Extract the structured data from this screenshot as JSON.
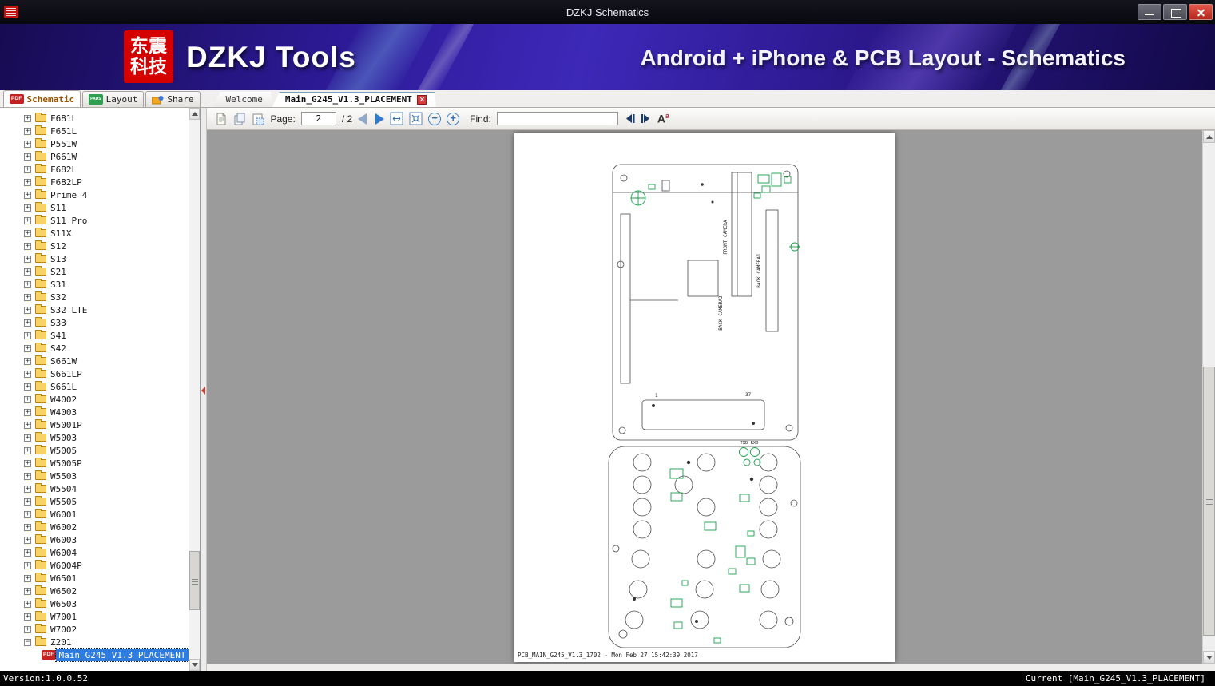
{
  "window": {
    "title": "DZKJ Schematics"
  },
  "banner": {
    "logo_line1": "东震",
    "logo_line2": "科技",
    "app_name": "DZKJ Tools",
    "tagline": "Android + iPhone & PCB Layout - Schematics"
  },
  "mode_tabs": [
    {
      "label": "Schematic",
      "active": true
    },
    {
      "label": "Layout",
      "active": false
    },
    {
      "label": "Share",
      "active": false
    }
  ],
  "doc_tabs": [
    {
      "label": "Welcome",
      "active": false,
      "closable": false
    },
    {
      "label": "Main_G245_V1.3_PLACEMENT",
      "active": true,
      "closable": true
    }
  ],
  "sidebar": {
    "items": [
      {
        "label": "F681L"
      },
      {
        "label": "F651L"
      },
      {
        "label": "P551W"
      },
      {
        "label": "P661W"
      },
      {
        "label": "F682L"
      },
      {
        "label": "F682LP"
      },
      {
        "label": "Prime 4"
      },
      {
        "label": "S11"
      },
      {
        "label": "S11 Pro"
      },
      {
        "label": "S11X"
      },
      {
        "label": "S12"
      },
      {
        "label": "S13"
      },
      {
        "label": "S21"
      },
      {
        "label": "S31"
      },
      {
        "label": "S32"
      },
      {
        "label": "S32 LTE"
      },
      {
        "label": "S33"
      },
      {
        "label": "S41"
      },
      {
        "label": "S42"
      },
      {
        "label": "S661W"
      },
      {
        "label": "S661LP"
      },
      {
        "label": "S661L"
      },
      {
        "label": "W4002"
      },
      {
        "label": "W4003"
      },
      {
        "label": "W5001P"
      },
      {
        "label": "W5003"
      },
      {
        "label": "W5005"
      },
      {
        "label": "W5005P"
      },
      {
        "label": "W5503"
      },
      {
        "label": "W5504"
      },
      {
        "label": "W5505"
      },
      {
        "label": "W6001"
      },
      {
        "label": "W6002"
      },
      {
        "label": "W6003"
      },
      {
        "label": "W6004"
      },
      {
        "label": "W6004P"
      },
      {
        "label": "W6501"
      },
      {
        "label": "W6502"
      },
      {
        "label": "W6503"
      },
      {
        "label": "W7001"
      },
      {
        "label": "W7002"
      },
      {
        "label": "Z201",
        "expanded": true
      }
    ],
    "child_item": {
      "label": "Main_G245_V1.3_PLACEMENT",
      "selected": true
    }
  },
  "toolbar": {
    "page_label": "Page:",
    "page_value": "2",
    "page_total": "/ 2",
    "find_label": "Find:",
    "find_value": ""
  },
  "viewer": {
    "page_footer": "PCB_MAIN_G245_V1.3_1702 - Mon Feb 27 15:42:39 2017",
    "drawing_labels": {
      "front_camera": "FRONT CAMERA",
      "back_camera1": "BACK CAMERA1",
      "back_camera2": "BACK CAMERA2",
      "txd_rxd": "TXD RXD",
      "pin_first": "1",
      "pin_last": "37"
    }
  },
  "icons": {
    "pdf_label": "PDF",
    "pads_label": "PADS",
    "match_case_big": "A",
    "match_case_small": "a"
  },
  "statusbar": {
    "version": "Version:1.0.0.52",
    "current": "Current [Main_G245_V1.3_PLACEMENT]"
  },
  "colors": {
    "accent_blue": "#2f7ce0",
    "pcb_green": "#18a04a",
    "logo_red": "#d50000",
    "banner_purple": "#3d28b8"
  }
}
